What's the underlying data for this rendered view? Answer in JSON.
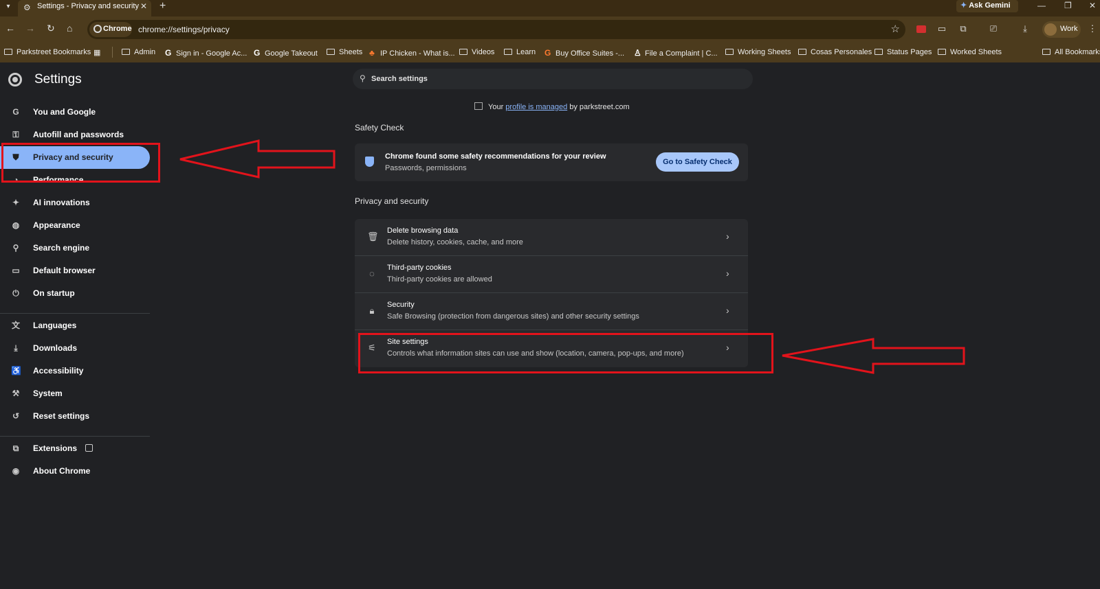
{
  "browser": {
    "tab_title": "Settings - Privacy and security",
    "tab_close": "✕",
    "new_tab": "+",
    "ask_gemini": "Ask Gemini",
    "chip_label": "Chrome",
    "url": "chrome://settings/privacy",
    "profile_label": "Work"
  },
  "bookmarks": [
    "Parkstreet Bookmarks",
    "Admin",
    "Sign in - Google Ac...",
    "Google Takeout",
    "Sheets",
    "IP Chicken - What is...",
    "Videos",
    "Learn",
    "Buy Office Suites -...",
    "File a Complaint | C...",
    "Working Sheets",
    "Cosas Personales",
    "Status Pages",
    "Worked Sheets",
    "All Bookmarks"
  ],
  "settings": {
    "title": "Settings",
    "search_placeholder": "Search settings",
    "managed": {
      "prefix": "Your",
      "link": "profile is managed",
      "suffix": "by parkstreet.com"
    },
    "nav": [
      {
        "label": "You and Google",
        "icon": "google-g-icon"
      },
      {
        "label": "Autofill and passwords",
        "icon": "key-icon"
      },
      {
        "label": "Privacy and security",
        "icon": "shield-icon",
        "active": true
      },
      {
        "label": "Performance",
        "icon": "speedometer-icon"
      },
      {
        "label": "AI innovations",
        "icon": "sparkle-icon"
      },
      {
        "label": "Appearance",
        "icon": "palette-icon"
      },
      {
        "label": "Search engine",
        "icon": "search-icon"
      },
      {
        "label": "Default browser",
        "icon": "browser-window-icon"
      },
      {
        "label": "On startup",
        "icon": "power-icon"
      },
      {
        "label": "Languages",
        "icon": "translate-icon"
      },
      {
        "label": "Downloads",
        "icon": "download-icon"
      },
      {
        "label": "Accessibility",
        "icon": "accessibility-icon"
      },
      {
        "label": "System",
        "icon": "wrench-icon"
      },
      {
        "label": "Reset settings",
        "icon": "reset-icon"
      },
      {
        "label": "Extensions",
        "icon": "puzzle-icon"
      },
      {
        "label": "About Chrome",
        "icon": "chrome-logo-icon"
      }
    ],
    "safety_check": {
      "section_title": "Safety Check",
      "title": "Chrome found some safety recommendations for your review",
      "subtitle": "Passwords, permissions",
      "button": "Go to Safety Check"
    },
    "privacy": {
      "section_title": "Privacy and security",
      "rows": [
        {
          "title": "Delete browsing data",
          "subtitle": "Delete history, cookies, cache, and more",
          "icon": "trash-icon"
        },
        {
          "title": "Third-party cookies",
          "subtitle": "Third-party cookies are allowed",
          "icon": "cookie-icon"
        },
        {
          "title": "Security",
          "subtitle": "Safe Browsing (protection from dangerous sites) and other security settings",
          "icon": "lock-icon"
        },
        {
          "title": "Site settings",
          "subtitle": "Controls what information sites can use and show (location, camera, pop-ups, and more)",
          "icon": "sliders-icon"
        }
      ]
    }
  },
  "colors": {
    "page_bg": "#202124",
    "active_nav": "#8ab4f8",
    "annotation_red": "#e2131b",
    "toolbar": "#4c3b1d"
  }
}
